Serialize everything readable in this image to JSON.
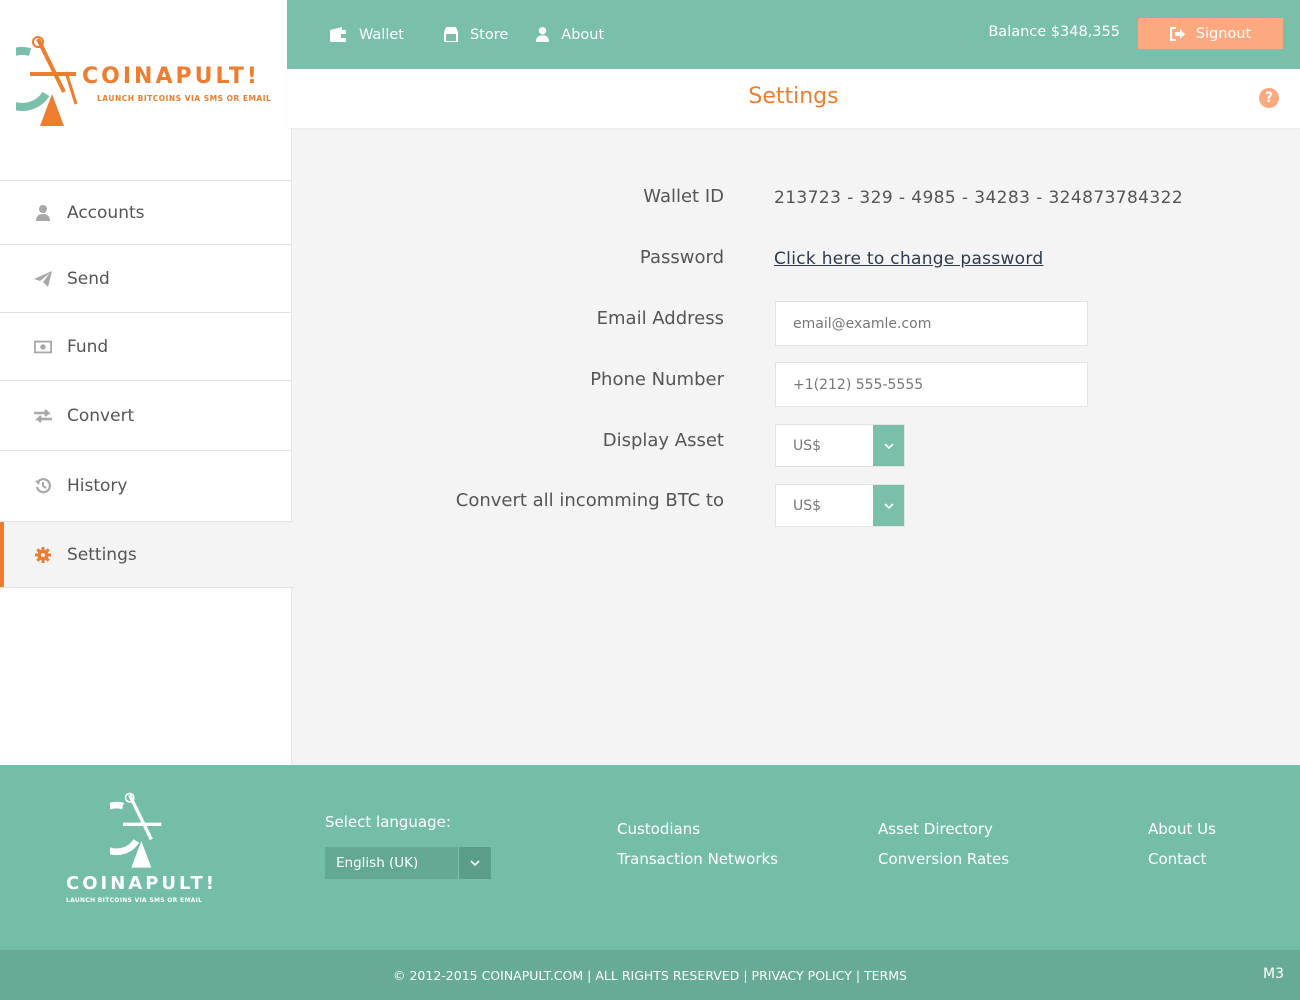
{
  "brand": {
    "name": "COINAPULT!",
    "tagline": "LAUNCH BITCOINS VIA SMS OR EMAIL",
    "accent_color": "#ee7d2f",
    "primary_color": "#79bfaa"
  },
  "topnav": {
    "items": [
      {
        "label": "Wallet",
        "icon": "wallet-icon"
      },
      {
        "label": "Store",
        "icon": "store-icon"
      },
      {
        "label": "About",
        "icon": "user-icon"
      }
    ],
    "balance": "Balance $348,355",
    "signout_label": "Signout"
  },
  "sidebar": {
    "items": [
      {
        "label": "Accounts",
        "icon": "user-icon"
      },
      {
        "label": "Send",
        "icon": "paper-plane-icon"
      },
      {
        "label": "Fund",
        "icon": "money-icon"
      },
      {
        "label": "Convert",
        "icon": "exchange-icon"
      },
      {
        "label": "History",
        "icon": "history-icon"
      },
      {
        "label": "Settings",
        "icon": "gear-icon",
        "active": true
      }
    ]
  },
  "page": {
    "title": "Settings",
    "help_icon": "?"
  },
  "form": {
    "wallet_id_label": "Wallet ID",
    "wallet_id_value": "213723 - 329 - 4985 - 34283 - 324873784322",
    "password_label": "Password",
    "password_link": "Click here to change password",
    "email_label": "Email Address",
    "email_placeholder": "email@examle.com",
    "phone_label": "Phone Number",
    "phone_placeholder": "+1(212) 555-5555",
    "display_asset_label": "Display Asset",
    "display_asset_value": "US$",
    "convert_label": "Convert all incomming BTC to",
    "convert_value": "US$"
  },
  "footer": {
    "language_label": "Select language:",
    "language_value": "English (UK)",
    "links": [
      "Custodians",
      "Transaction Networks",
      "Asset Directory",
      "Conversion Rates",
      "About Us",
      "Contact"
    ],
    "copyright": "© 2012-2015 COINAPULT.COM",
    "rights": "ALL RIGHTS RESERVED",
    "privacy": "PRIVACY POLICY",
    "terms": "TERMS",
    "version": "M3"
  }
}
